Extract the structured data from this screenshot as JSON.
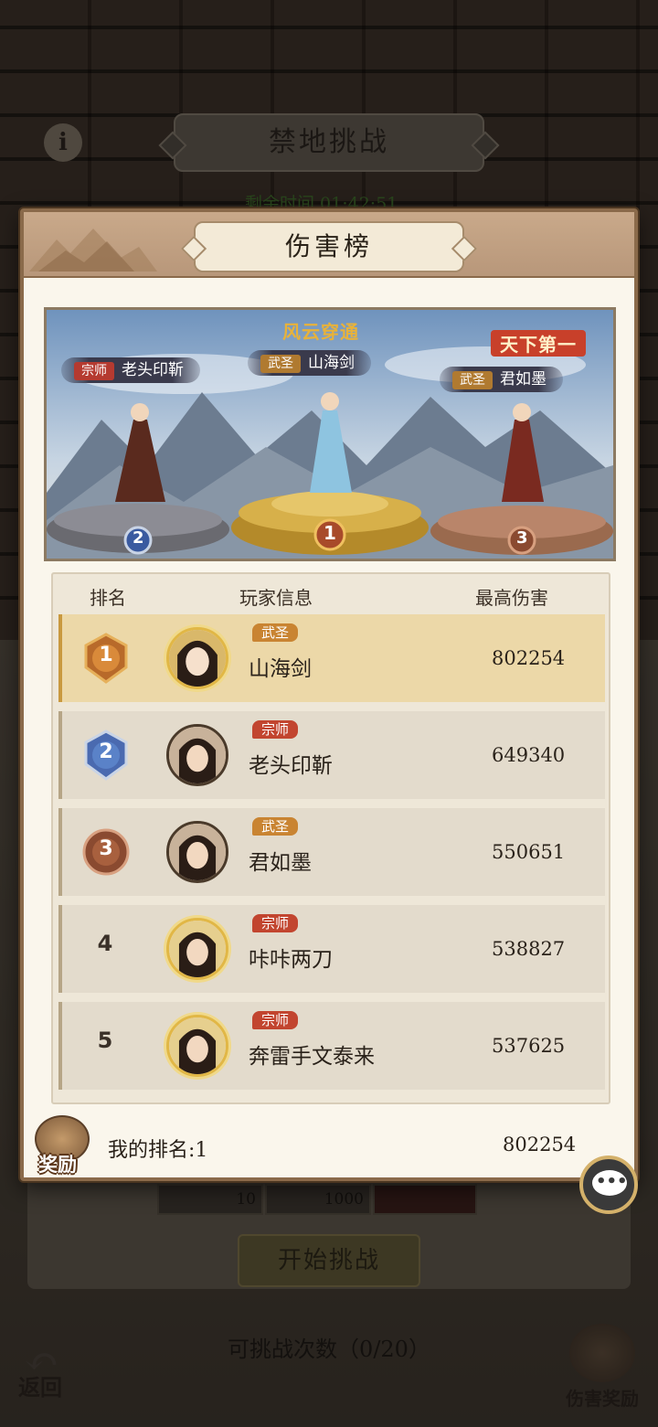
{
  "background": {
    "screen_title": "禁地挑战",
    "timer_text": "剩余时间 01:42:51",
    "reward_cells": [
      "10",
      "1000"
    ],
    "start_button": "开始挑战",
    "attempts": "可挑战次数（0/20）",
    "back_label": "返回",
    "damage_reward_label": "伤害奖励",
    "info_icon": "i"
  },
  "modal": {
    "title": "伤害榜",
    "podium": {
      "first": {
        "title": "武圣",
        "name": "山海剑",
        "banner": "风云穿通",
        "rank": "1"
      },
      "second": {
        "title": "宗师",
        "name": "老头印靳",
        "rank": "2"
      },
      "third": {
        "title": "武圣",
        "name": "君如墨",
        "banner": "天下第一",
        "rank": "3"
      }
    },
    "table": {
      "headers": {
        "rank": "排名",
        "info": "玩家信息",
        "damage": "最高伤害"
      },
      "rows": [
        {
          "rank": "1",
          "title": "武圣",
          "name": "山海剑",
          "damage": "802254"
        },
        {
          "rank": "2",
          "title": "宗师",
          "name": "老头印靳",
          "damage": "649340"
        },
        {
          "rank": "3",
          "title": "武圣",
          "name": "君如墨",
          "damage": "550651"
        },
        {
          "rank": "4",
          "title": "宗师",
          "name": "咔咔两刀",
          "damage": "538827"
        },
        {
          "rank": "5",
          "title": "宗师",
          "name": "奔雷手文泰来",
          "damage": "537625"
        }
      ]
    },
    "my_rank": "我的排名:1",
    "my_damage": "802254",
    "reward_label": "奖励"
  },
  "colors": {
    "gold_row": "#ecd8a8",
    "row": "#e3dbcc",
    "zongshi_badge": "#c2452f",
    "wusheng_badge": "#c98432"
  }
}
